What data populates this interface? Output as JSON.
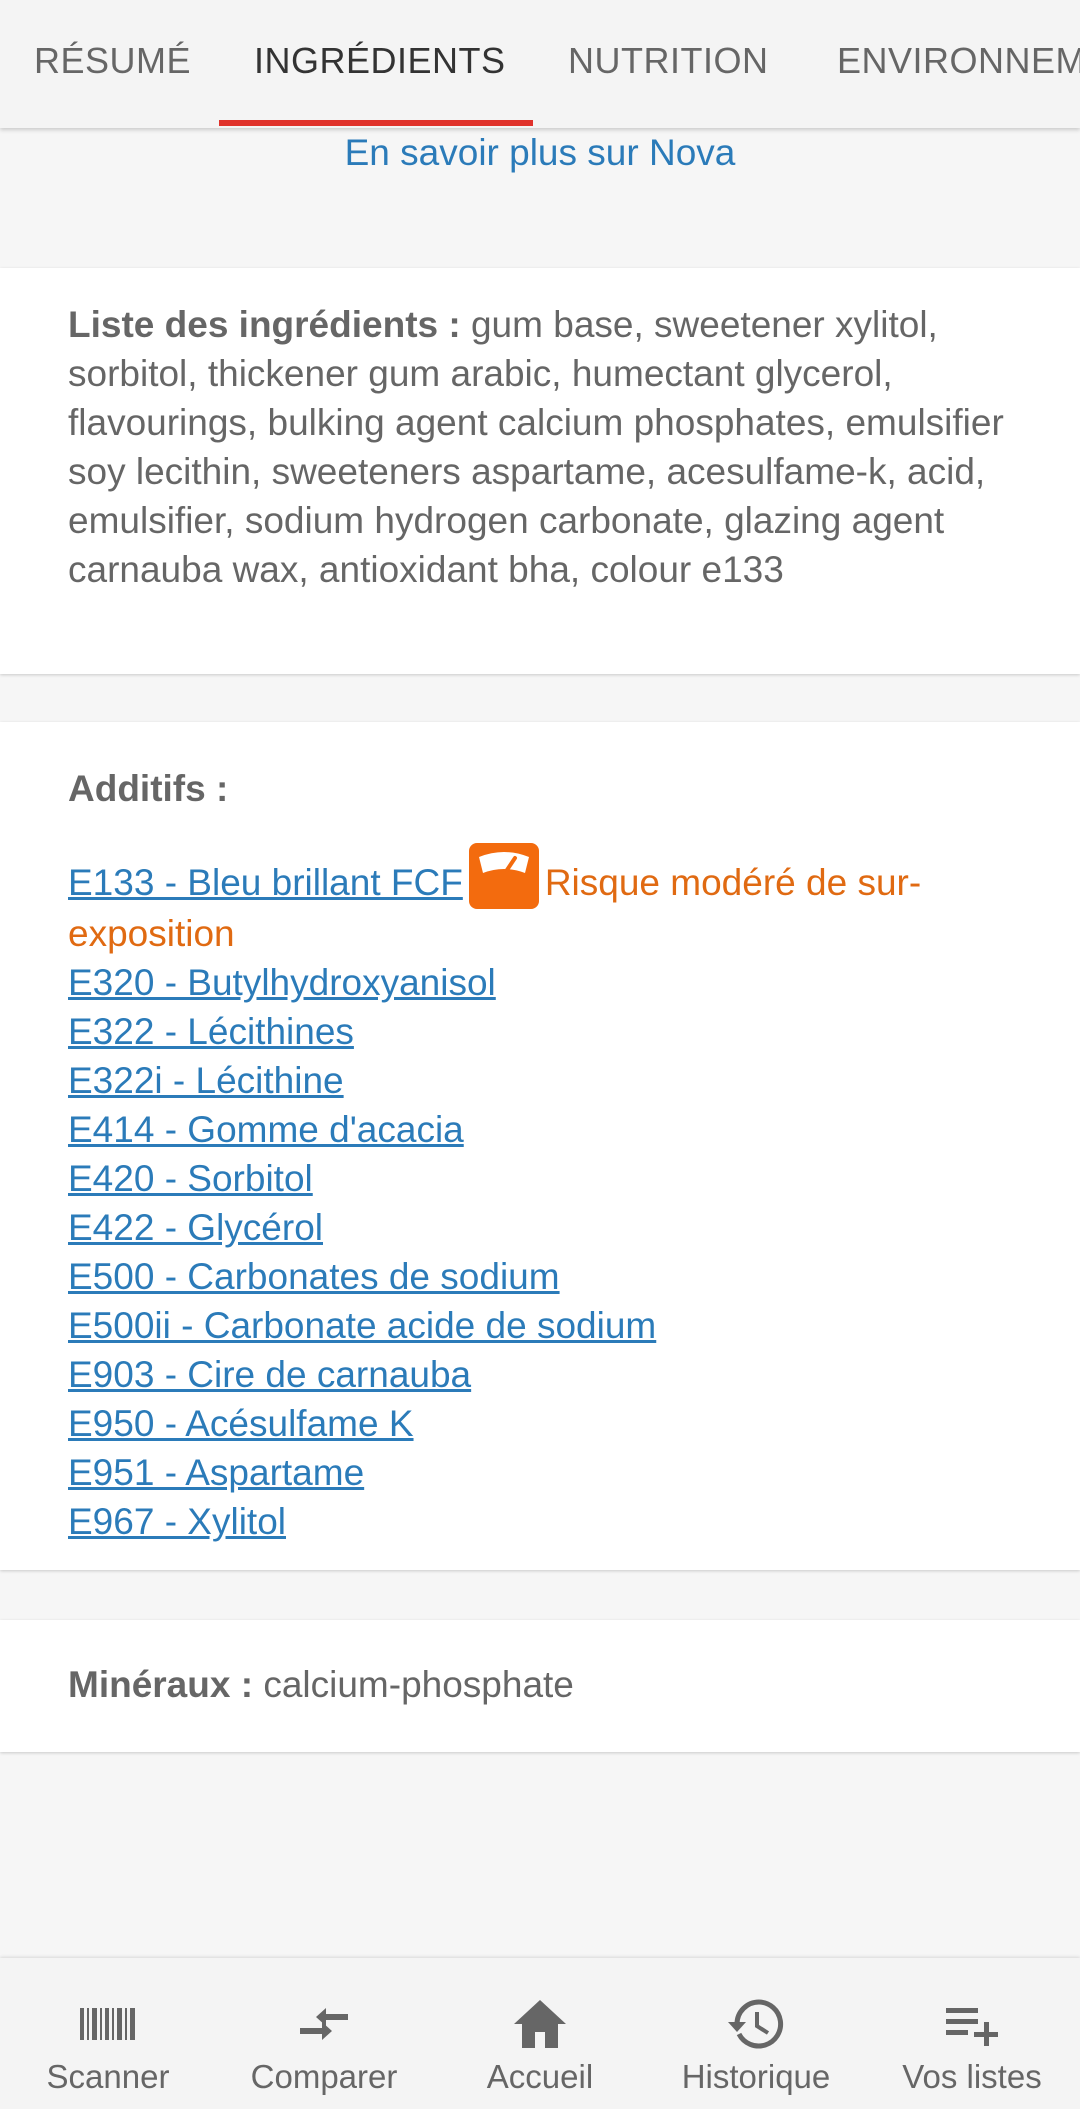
{
  "tabs": [
    {
      "label": "RÉSUMÉ"
    },
    {
      "label": "INGRÉDIENTS"
    },
    {
      "label": "NUTRITION"
    },
    {
      "label": "ENVIRONNEM"
    }
  ],
  "nova_link": "En savoir plus sur Nova",
  "ingredients": {
    "label": "Liste des ingrédients : ",
    "text": "gum base, sweetener xylitol, sorbitol, thickener gum arabic, humectant glycerol, flavourings, bulking agent calcium phosphates, emulsifier soy lecithin, sweeteners aspartame, acesulfame-k, acid, emulsifier, sodium hydrogen carbonate, glazing agent carnauba wax, antioxidant bha, colour e133"
  },
  "additives": {
    "title": "Additifs :",
    "first": {
      "label": "E133 - Bleu brillant FCF",
      "risk_icon": "scale-icon",
      "risk": "Risque modéré de sur-exposition"
    },
    "items": [
      "E320 - Butylhydroxyanisol",
      "E322 - Lécithines",
      "E322i - Lécithine",
      "E414 - Gomme d'acacia",
      "E420 - Sorbitol",
      "E422 - Glycérol",
      "E500 - Carbonates de sodium",
      "E500ii - Carbonate acide de sodium",
      "E903 - Cire de carnauba",
      "E950 - Acésulfame K",
      "E951 - Aspartame",
      "E967 - Xylitol"
    ]
  },
  "minerals": {
    "label": "Minéraux : ",
    "value": "calcium-phosphate"
  },
  "bottom_nav": [
    {
      "label": "Scanner",
      "icon": "barcode-icon"
    },
    {
      "label": "Comparer",
      "icon": "compare-icon"
    },
    {
      "label": "Accueil",
      "icon": "home-icon"
    },
    {
      "label": "Historique",
      "icon": "history-icon"
    },
    {
      "label": "Vos listes",
      "icon": "playlist-add-icon"
    }
  ],
  "colors": {
    "link": "#2b7bb9",
    "tab_indicator": "#e0322b",
    "risk": "#f36b0e"
  }
}
